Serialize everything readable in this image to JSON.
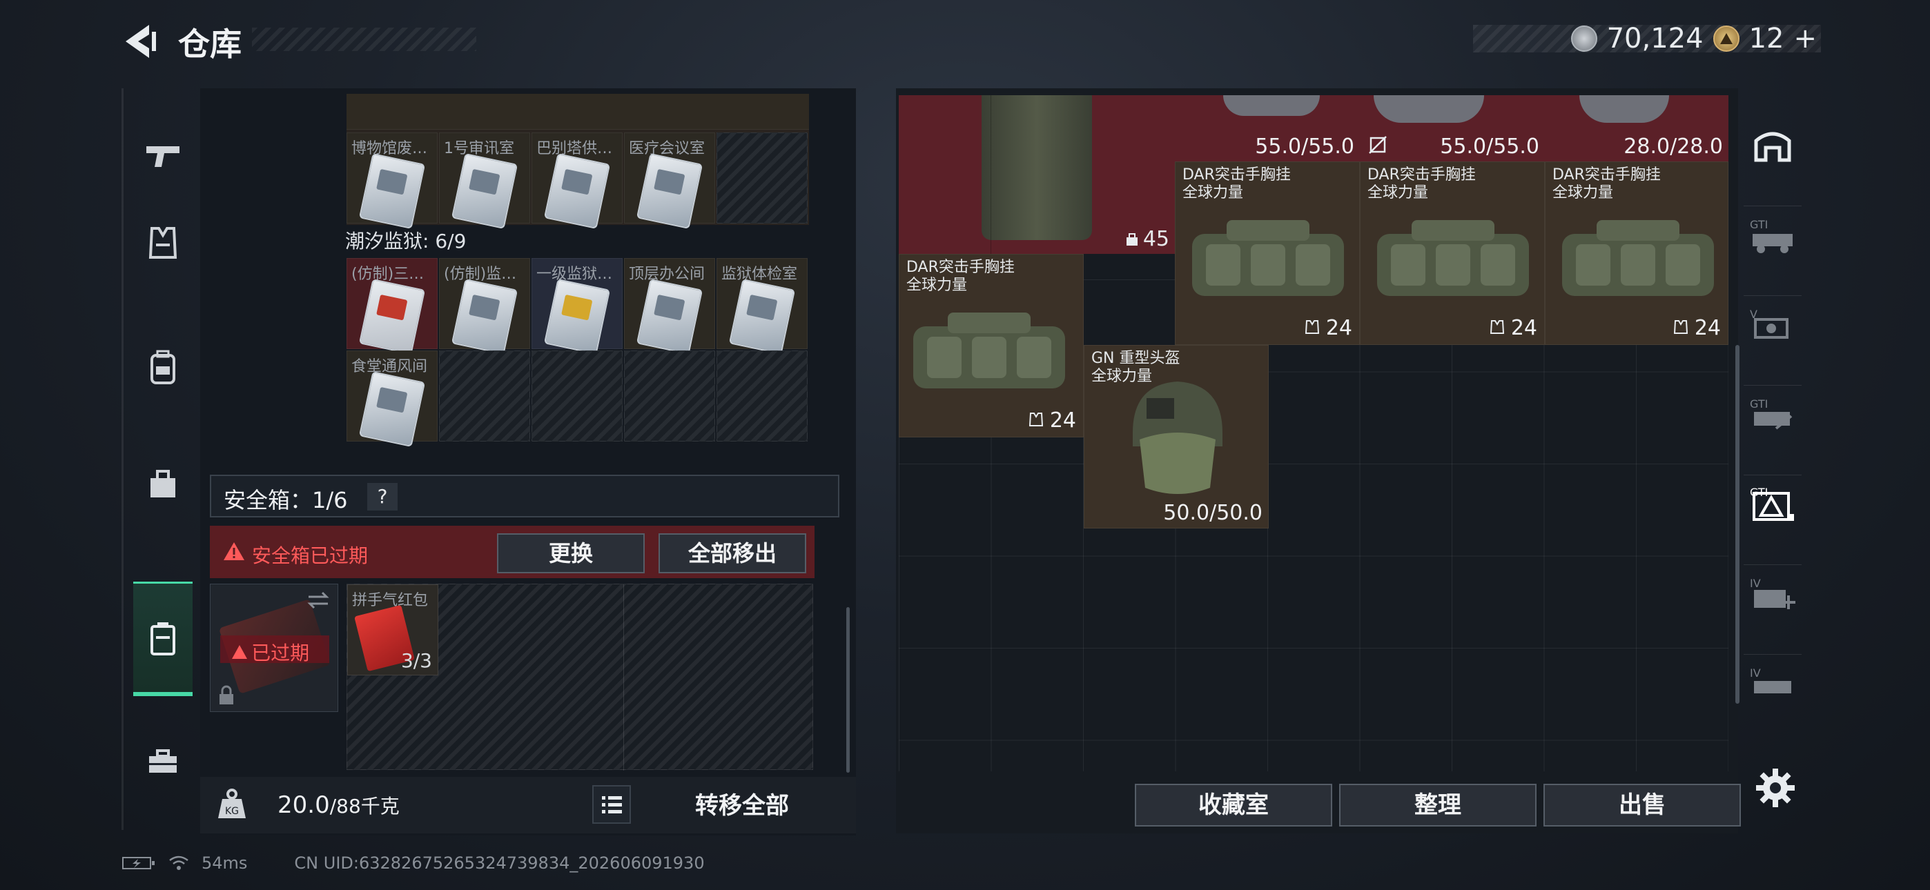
{
  "header": {
    "title": "仓库",
    "currency1_value": "70,124",
    "currency2_value": "12",
    "currency2_add": "+"
  },
  "left_nav": {
    "items": [
      "pistol-icon",
      "armor-vest-icon",
      "backpack-icon",
      "bag-icon",
      "case-icon",
      "toolbox-icon"
    ],
    "active_index": 4
  },
  "storage": {
    "row1_labels": [
      "博物馆废…",
      "1号审讯室",
      "巴别塔供…",
      "医疗会议室"
    ],
    "prison_label": "潮汐监狱: 6/9",
    "row2_labels": [
      "(仿制)三…",
      "(仿制)监…",
      "一级监狱…",
      "顶层办公间",
      "监狱体检室"
    ],
    "row3_labels": [
      "食堂通风间"
    ]
  },
  "safebox": {
    "title": "安全箱：1/6",
    "help": "?",
    "expired_warning": "安全箱已过期",
    "replace_label": "更换",
    "move_all_label": "全部移出",
    "expired_badge": "已过期",
    "item_name": "拼手气红包",
    "item_count": "3/3"
  },
  "left_footer": {
    "weight_value": "20.0",
    "weight_capacity": "/88千克",
    "transfer_all_label": "转移全部"
  },
  "right_items": {
    "top_durabilities": [
      "55.0/55.0",
      "55.0/55.0",
      "28.0/28.0"
    ],
    "vest_count": "45",
    "bags": [
      {
        "name_line1": "DAR突击手胸挂",
        "name_line2": "全球力量",
        "count": "24"
      },
      {
        "name_line1": "DAR突击手胸挂",
        "name_line2": "全球力量",
        "count": "24"
      },
      {
        "name_line1": "DAR突击手胸挂",
        "name_line2": "全球力量",
        "count": "24"
      },
      {
        "name_line1": "DAR突击手胸挂",
        "name_line2": "全球力量",
        "count": "24"
      }
    ],
    "helmet": {
      "name_line1": "GN 重型头盔",
      "name_line2": "全球力量",
      "durability": "50.0/50.0"
    }
  },
  "right_footer": {
    "collection_label": "收藏室",
    "arrange_label": "整理",
    "sell_label": "出售"
  },
  "right_nav": {
    "items": [
      "home-bunker-icon",
      "gti-vehicle-icon",
      "v-vehicle-icon",
      "gti-cart-icon",
      "gti-warning-icon",
      "iv-medical-icon",
      "iv-vehicle-icon"
    ],
    "active_index": 4
  },
  "status": {
    "ping": "54ms",
    "uid": "CN UID:63282675265324739834_202606091930"
  },
  "colors": {
    "accent_green": "#47d8a6",
    "warning_red": "#ff5a5a",
    "expired_bg": "#5a1d22",
    "item_red_bg": "#5b2028",
    "item_tan_bg": "#3b3127"
  }
}
